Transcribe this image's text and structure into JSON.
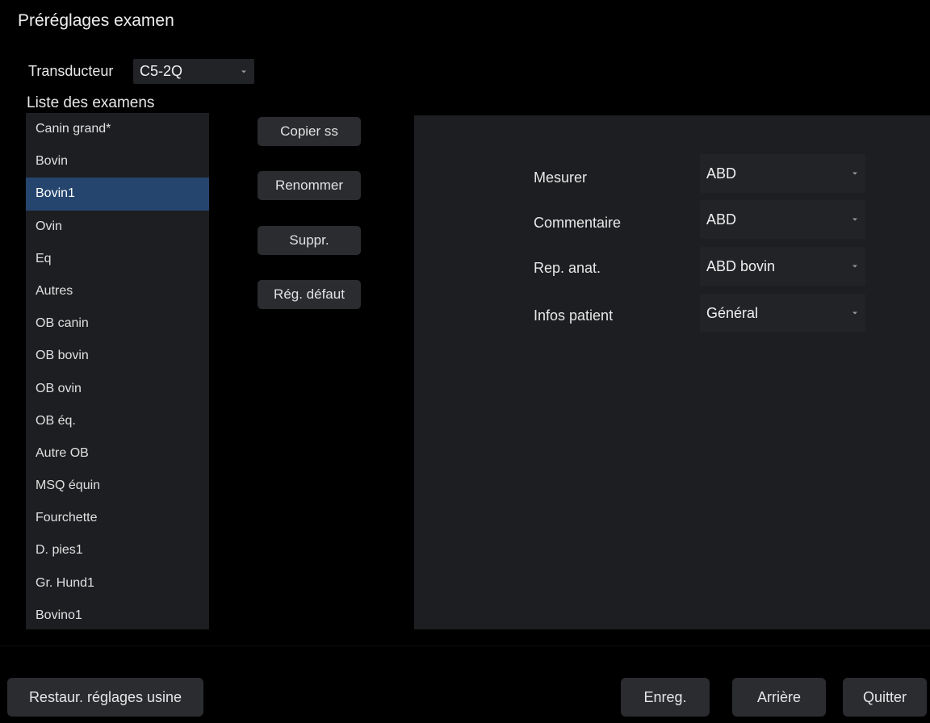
{
  "window": {
    "title": "Préréglages examen"
  },
  "transducer": {
    "label": "Transducteur",
    "value": "C5-2Q"
  },
  "exam_list": {
    "label": "Liste des examens",
    "items": [
      "Canin grand*",
      "Bovin",
      "Bovin1",
      "Ovin",
      "Eq",
      "Autres",
      "OB canin",
      "OB bovin",
      "OB ovin",
      "OB éq.",
      "Autre OB",
      "MSQ équin",
      "Fourchette",
      "D. pies1",
      "Gr. Hund1",
      "Bovino1"
    ],
    "selected": "Bovin1"
  },
  "actions": {
    "copy": "Copier ss",
    "rename": "Renommer",
    "delete": "Suppr.",
    "default": "Rég. défaut"
  },
  "settings": {
    "measure": {
      "label": "Mesurer",
      "value": "ABD"
    },
    "comment": {
      "label": "Commentaire",
      "value": "ABD"
    },
    "bodymark": {
      "label": "Rep. anat.",
      "value": "ABD bovin"
    },
    "patient_info": {
      "label": "Infos patient",
      "value": "Général"
    }
  },
  "footer": {
    "restore": "Restaur. réglages usine",
    "save": "Enreg.",
    "back": "Arrière",
    "quit": "Quitter"
  },
  "colors": {
    "background": "#000000",
    "panel": "#1d1e21",
    "selected_row": "#25456e",
    "button": "#2b2c30"
  }
}
